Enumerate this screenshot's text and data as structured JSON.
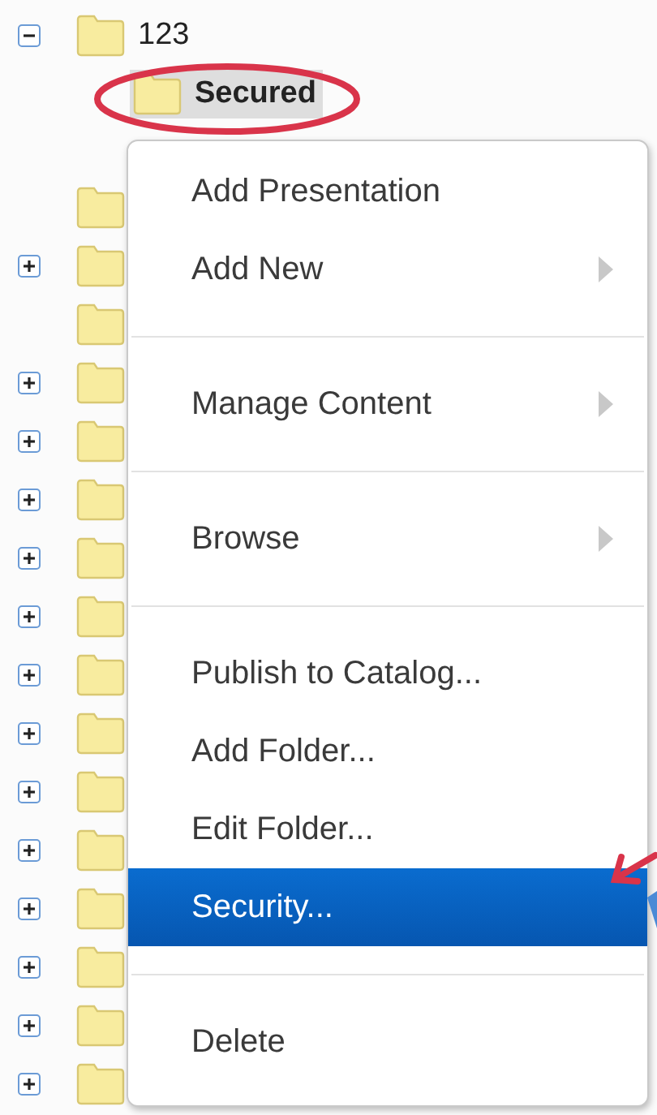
{
  "tree": [
    {
      "label": "123",
      "expandable": true,
      "expanded": true,
      "selected": false,
      "children": [
        {
          "label": "Secured",
          "expandable": false,
          "selected": true
        }
      ]
    },
    {
      "expandable": false
    },
    {
      "expandable": true,
      "expanded": false
    },
    {
      "expandable": false
    },
    {
      "expandable": true,
      "expanded": false
    },
    {
      "expandable": true,
      "expanded": false
    },
    {
      "expandable": true,
      "expanded": false
    },
    {
      "expandable": true,
      "expanded": false
    },
    {
      "expandable": true,
      "expanded": false
    },
    {
      "expandable": true,
      "expanded": false
    },
    {
      "expandable": true,
      "expanded": false
    },
    {
      "expandable": true,
      "expanded": false
    },
    {
      "expandable": true,
      "expanded": false
    },
    {
      "expandable": true,
      "expanded": false
    },
    {
      "expandable": true,
      "expanded": false
    },
    {
      "expandable": true,
      "expanded": false
    },
    {
      "expandable": true,
      "expanded": false
    }
  ],
  "context_menu": {
    "groups": [
      [
        {
          "label": "Add Presentation",
          "submenu": false,
          "selected": false
        },
        {
          "label": "Add New",
          "submenu": true,
          "selected": false
        }
      ],
      [
        {
          "label": "Manage Content",
          "submenu": true,
          "selected": false
        }
      ],
      [
        {
          "label": "Browse",
          "submenu": true,
          "selected": false
        }
      ],
      [
        {
          "label": "Publish to Catalog...",
          "submenu": false,
          "selected": false
        },
        {
          "label": "Add Folder...",
          "submenu": false,
          "selected": false
        },
        {
          "label": "Edit Folder...",
          "submenu": false,
          "selected": false
        },
        {
          "label": "Security...",
          "submenu": false,
          "selected": true
        }
      ],
      [
        {
          "label": "Delete",
          "submenu": false,
          "selected": false
        }
      ]
    ]
  }
}
